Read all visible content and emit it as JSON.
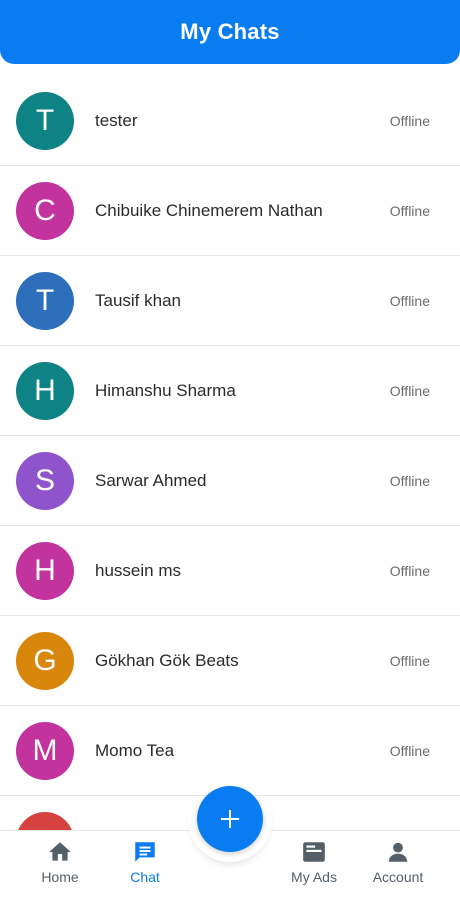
{
  "header": {
    "title": "My Chats"
  },
  "chats": [
    {
      "initial": "T",
      "name": "tester",
      "status": "Offline",
      "color": "#0d8386"
    },
    {
      "initial": "C",
      "name": "Chibuike Chinemerem Nathan",
      "status": "Offline",
      "color": "#c2339e"
    },
    {
      "initial": "T",
      "name": "Tausif khan",
      "status": "Offline",
      "color": "#2d6fba"
    },
    {
      "initial": "H",
      "name": "Himanshu Sharma",
      "status": "Offline",
      "color": "#0d8386"
    },
    {
      "initial": "S",
      "name": "Sarwar Ahmed",
      "status": "Offline",
      "color": "#8f54cc"
    },
    {
      "initial": "H",
      "name": "hussein ms",
      "status": "Offline",
      "color": "#c2339e"
    },
    {
      "initial": "G",
      "name": "Gökhan Gök Beats",
      "status": "Offline",
      "color": "#d9860c"
    },
    {
      "initial": "M",
      "name": "Momo Tea",
      "status": "Offline",
      "color": "#c2339e"
    },
    {
      "initial": "",
      "name": "",
      "status": "",
      "color": "#d6423f"
    }
  ],
  "nav": {
    "home": {
      "label": "Home",
      "icon": "home-icon"
    },
    "chat": {
      "label": "Chat",
      "icon": "chat-icon"
    },
    "myads": {
      "label": "My Ads",
      "icon": "ads-icon"
    },
    "account": {
      "label": "Account",
      "icon": "account-icon"
    }
  },
  "fab": {
    "icon": "plus-icon"
  },
  "colors": {
    "primary": "#0a7cf2",
    "nav_inactive": "#555f6a"
  }
}
